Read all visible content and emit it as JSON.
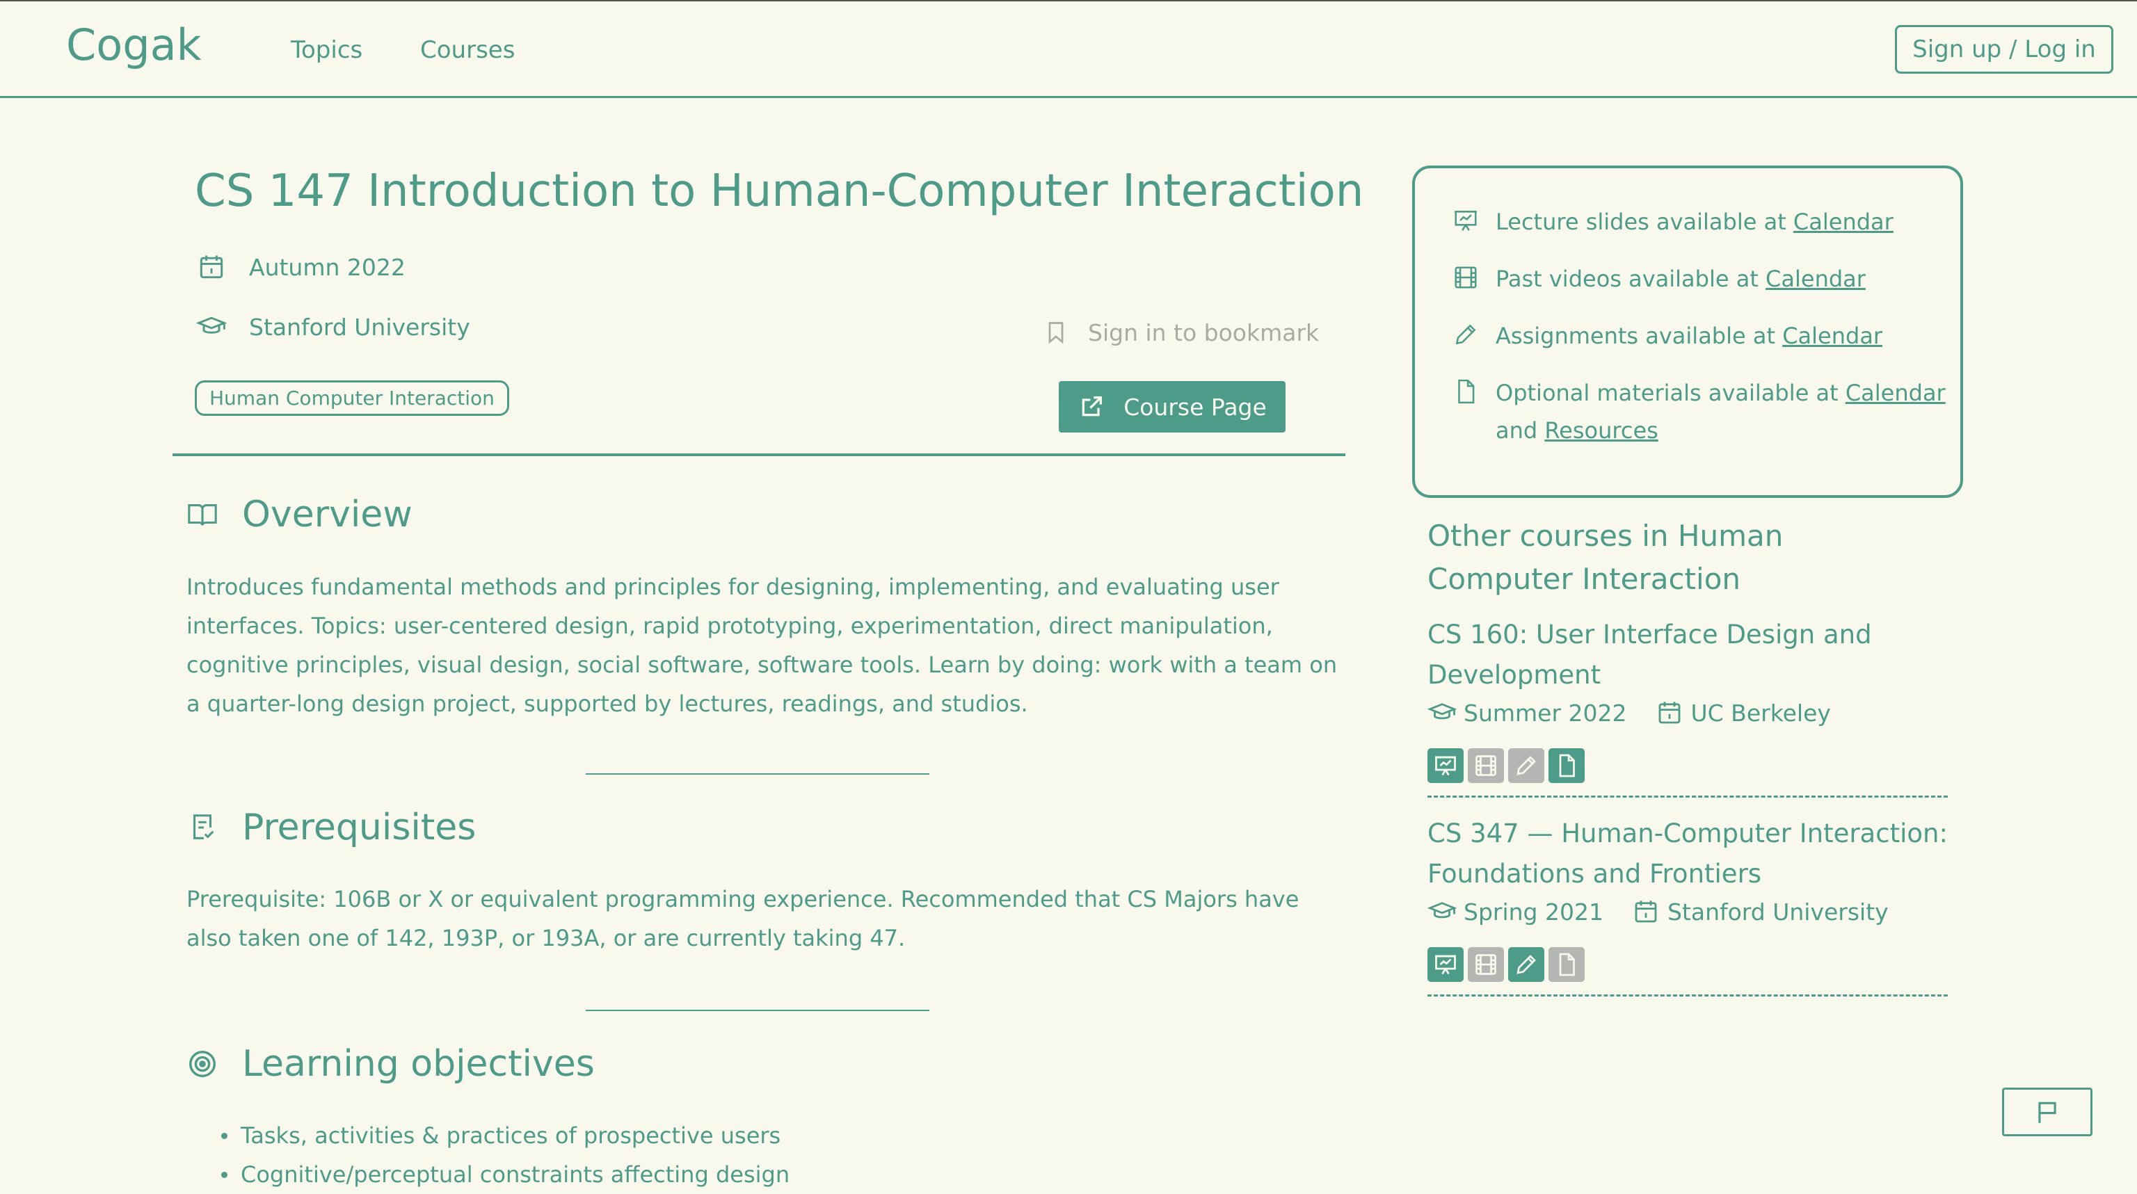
{
  "nav": {
    "logo": "Cogak",
    "links": [
      "Topics",
      "Courses"
    ],
    "auth_label": "Sign up / Log in"
  },
  "course": {
    "title": "CS 147 Introduction to Human-Computer Interaction",
    "term": "Autumn 2022",
    "university": "Stanford University",
    "tag": "Human Computer Interaction",
    "bookmark_label": "Sign in to bookmark",
    "course_page_label": "Course Page"
  },
  "sections": {
    "overview": {
      "heading": "Overview",
      "text": "Introduces fundamental methods and principles for designing, implementing, and evaluating user interfaces. Topics: user-centered design, rapid prototyping, experimentation, direct manipulation, cognitive principles, visual design, social software, software tools. Learn by doing: work with a team on a quarter-long design project, supported by lectures, readings, and studios."
    },
    "prerequisites": {
      "heading": "Prerequisites",
      "text": "Prerequisite: 106B or X or equivalent programming experience. Recommended that CS Majors have also taken one of 142, 193P, or 193A, or are currently taking 47."
    },
    "learning": {
      "heading": "Learning objectives",
      "items": [
        "Tasks, activities & practices of prospective users",
        "Cognitive/perceptual constraints affecting design"
      ]
    }
  },
  "resources": {
    "lecture_prefix": "Lecture slides available at ",
    "videos_prefix": "Past videos available at ",
    "assignments_prefix": "Assignments available at ",
    "optional_prefix": "Optional materials available at ",
    "calendar_link": "Calendar",
    "and_word": "and ",
    "resources_link": "Resources"
  },
  "other_courses": {
    "heading": "Other courses in Human Computer Interaction",
    "items": [
      {
        "title": "CS 160: User Interface Design and Development",
        "term": "Summer 2022",
        "university": "UC Berkeley",
        "badges": {
          "slides": true,
          "videos": false,
          "assignments": false,
          "materials": true
        }
      },
      {
        "title": "CS 347 — Human-Computer Interaction: Foundations and Frontiers",
        "term": "Spring 2021",
        "university": "Stanford University",
        "badges": {
          "slides": true,
          "videos": false,
          "assignments": true,
          "materials": false
        }
      }
    ]
  },
  "icons": [
    "calendar-icon",
    "graduation-cap-icon",
    "bookmark-icon",
    "external-link-icon",
    "book-icon",
    "checklist-icon",
    "target-icon",
    "presentation-icon",
    "film-icon",
    "pencil-icon",
    "file-icon",
    "flag-icon"
  ],
  "colors": {
    "accent": "#4d9b89",
    "background": "#f9f8ec",
    "muted": "#b3b6b2"
  }
}
